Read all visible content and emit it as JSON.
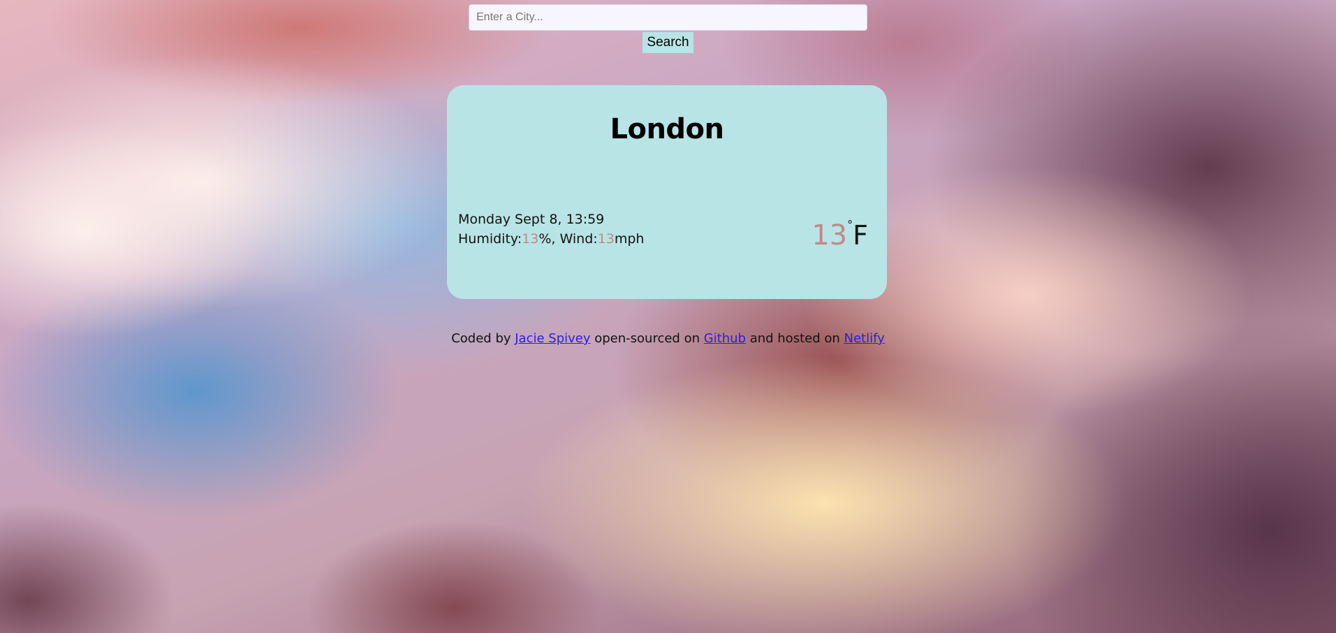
{
  "search": {
    "placeholder": "Enter a City...",
    "value": "",
    "button_label": "Search"
  },
  "weather": {
    "city": "London",
    "datetime": "Monday Sept 8, 13:59",
    "humidity_label": "Humidity:",
    "humidity_value": "13",
    "humidity_unit": "%, ",
    "wind_label": "Wind:",
    "wind_value": "13",
    "wind_unit": "mph",
    "temperature": "13",
    "degree_symbol": "°",
    "temperature_unit": "F"
  },
  "footer": {
    "text_1": "Coded by ",
    "author_link": "Jacie Spivey",
    "text_2": " open-sourced on ",
    "github_link": "Github",
    "text_3": " and hosted on ",
    "netlify_link": "Netlify"
  },
  "colors": {
    "card_background": "#b9e4e6",
    "accent": "#c08988",
    "link": "#2a1fd8"
  }
}
